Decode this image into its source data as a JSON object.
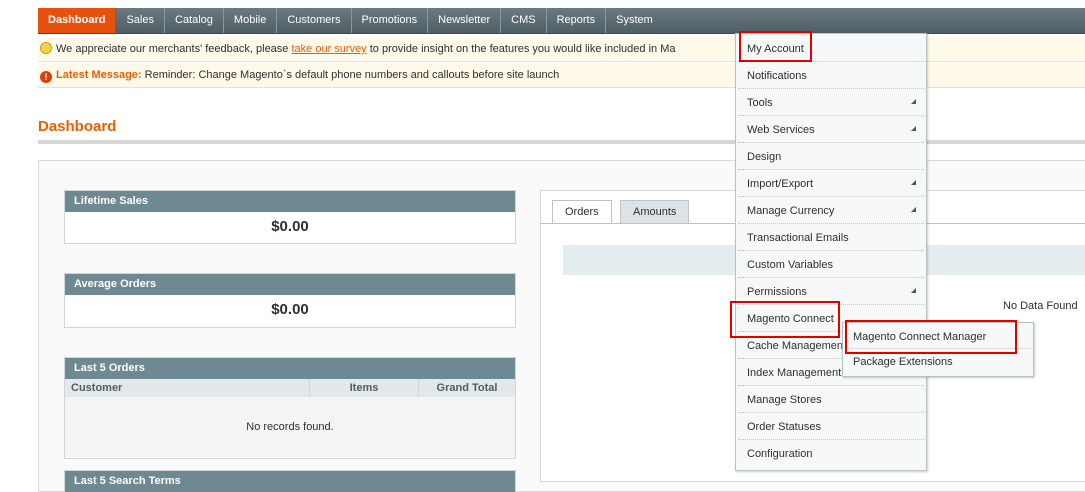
{
  "nav": {
    "items": [
      "Dashboard",
      "Sales",
      "Catalog",
      "Mobile",
      "Customers",
      "Promotions",
      "Newsletter",
      "CMS",
      "Reports",
      "System"
    ]
  },
  "notices": {
    "survey_pre": "We appreciate our merchants' feedback, please ",
    "survey_link": "take our survey",
    "survey_post": " to provide insight on the features you would like included in Ma",
    "latest_label": "Latest Message:",
    "latest_text": " Reminder: Change Magento`s default phone numbers and callouts before site launch"
  },
  "page": {
    "title": "Dashboard"
  },
  "widgets": {
    "lifetime_sales": {
      "label": "Lifetime Sales",
      "value": "$0.00"
    },
    "average_orders": {
      "label": "Average Orders",
      "value": "$0.00"
    },
    "last_orders": {
      "label": "Last 5 Orders",
      "columns": [
        "Customer",
        "Items",
        "Grand Total"
      ],
      "empty": "No records found."
    },
    "last_search": {
      "label": "Last 5 Search Terms"
    }
  },
  "chart": {
    "tabs": [
      "Orders",
      "Amounts"
    ],
    "nodata": "No Data Found"
  },
  "system_menu": {
    "items": [
      {
        "label": "My Account",
        "arrow": false
      },
      {
        "label": "Notifications",
        "arrow": false
      },
      {
        "label": "Tools",
        "arrow": true
      },
      {
        "label": "Web Services",
        "arrow": true
      },
      {
        "label": "Design",
        "arrow": false
      },
      {
        "label": "Import/Export",
        "arrow": true
      },
      {
        "label": "Manage Currency",
        "arrow": true
      },
      {
        "label": "Transactional Emails",
        "arrow": false
      },
      {
        "label": "Custom Variables",
        "arrow": false
      },
      {
        "label": "Permissions",
        "arrow": true
      },
      {
        "label": "Magento Connect",
        "arrow": false
      },
      {
        "label": "Cache Management",
        "arrow": false
      },
      {
        "label": "Index Management",
        "arrow": false
      },
      {
        "label": "Manage Stores",
        "arrow": false
      },
      {
        "label": "Order Statuses",
        "arrow": false
      },
      {
        "label": "Configuration",
        "arrow": false
      }
    ],
    "submenu": [
      "Magento Connect Manager",
      "Package Extensions"
    ]
  },
  "colors": {
    "accent": "#eb5e00",
    "nav_active": "#e6510f",
    "highlight": "#e00000"
  }
}
